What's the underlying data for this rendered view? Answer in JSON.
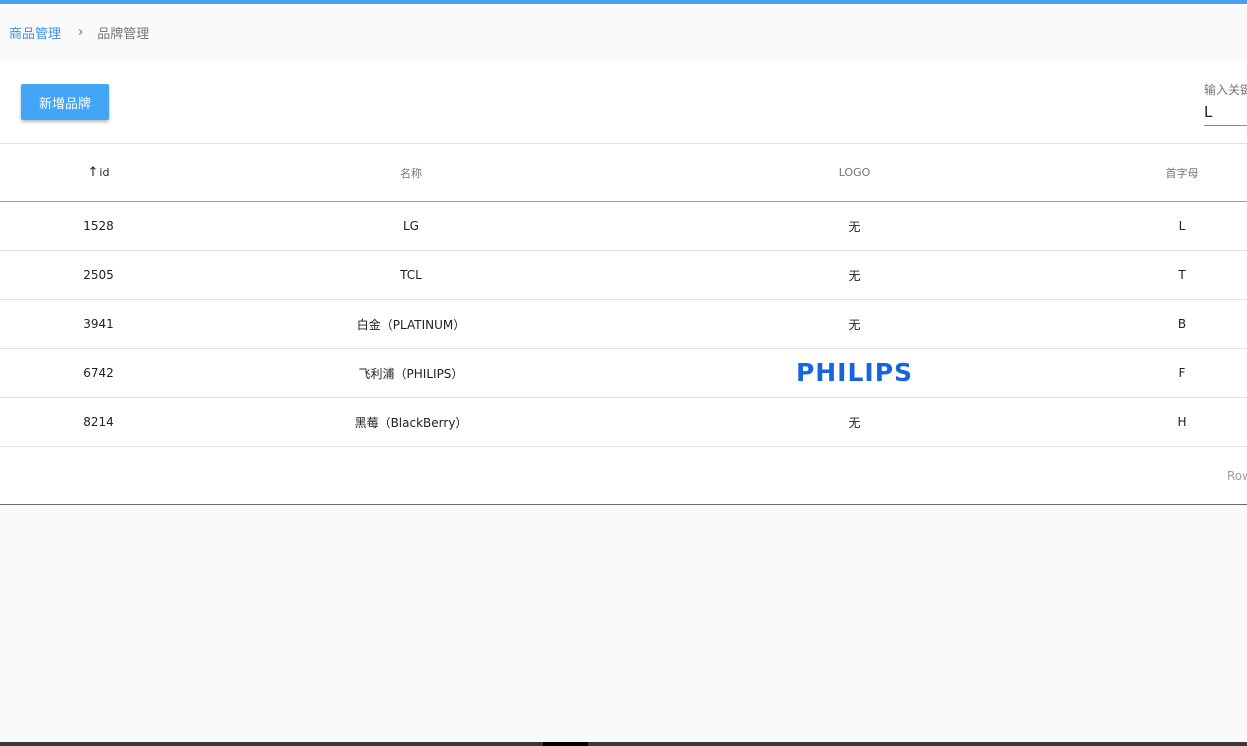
{
  "breadcrumb": {
    "parent": "商品管理",
    "separator": "›",
    "current": "品牌管理"
  },
  "toolbar": {
    "add_label": "新增品牌",
    "search_label": "输入关键字",
    "search_value": "L"
  },
  "table": {
    "headers": {
      "id": "id",
      "name": "名称",
      "logo": "LOGO",
      "letter": "首字母"
    },
    "sort_icon": "arrow-up-icon",
    "rows": [
      {
        "id": "1528",
        "name": "LG",
        "logo": "无",
        "letter": "L"
      },
      {
        "id": "2505",
        "name": "TCL",
        "logo": "无",
        "letter": "T"
      },
      {
        "id": "3941",
        "name": "白金（PLATINUM）",
        "logo": "无",
        "letter": "B"
      },
      {
        "id": "6742",
        "name": "飞利浦（PHILIPS）",
        "logo": "PHILIPS",
        "letter": "F"
      },
      {
        "id": "8214",
        "name": "黑莓（BlackBerry）",
        "logo": "无",
        "letter": "H"
      }
    ]
  },
  "footer": {
    "rows_label": "Rows per page:"
  },
  "colors": {
    "accent": "#4a9ff0",
    "button": "#42a5f5",
    "link": "#3f8ee8",
    "philips_blue": "#1565e0"
  }
}
